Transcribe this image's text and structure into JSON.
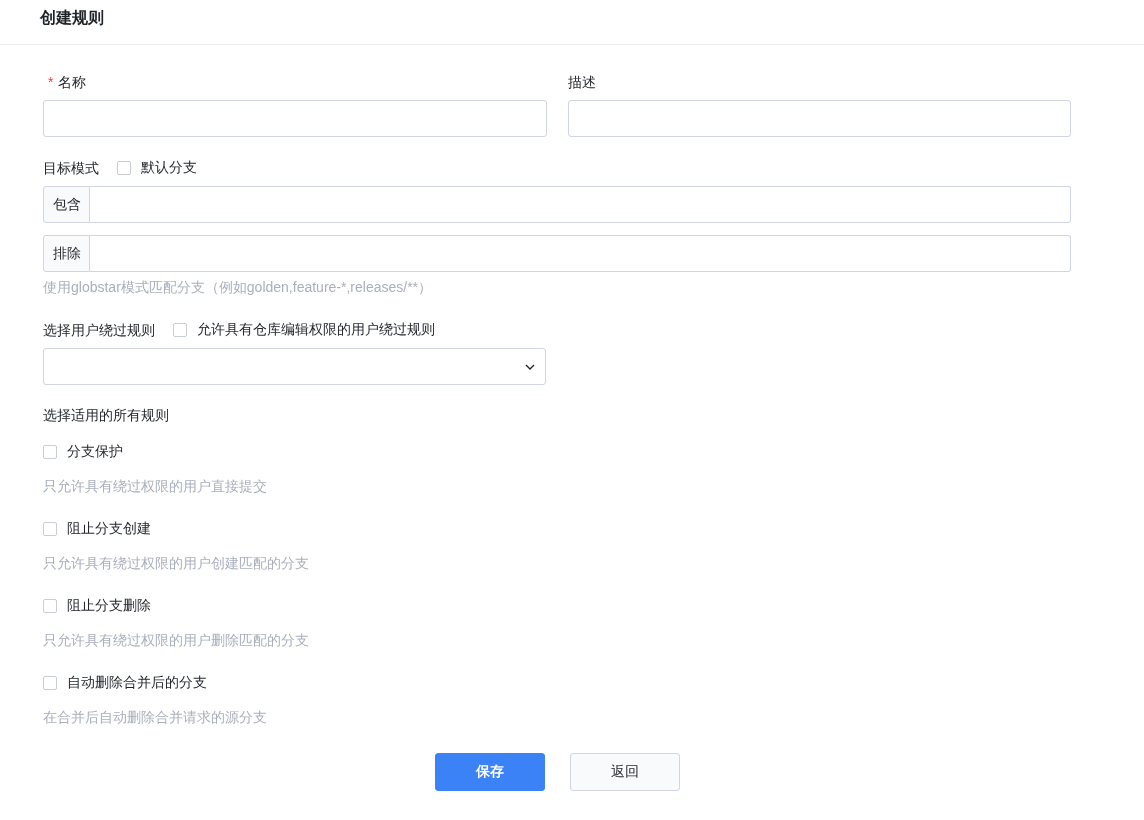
{
  "title": "创建规则",
  "name_field": {
    "required_mark": "*",
    "label": "名称"
  },
  "description_field": {
    "label": "描述"
  },
  "target_pattern": {
    "label": "目标模式",
    "default_branch": {
      "label": "默认分支",
      "checked": false
    },
    "include": {
      "addon": "包含"
    },
    "exclude": {
      "addon": "排除"
    },
    "hint": "使用globstar模式匹配分支（例如golden,feature-*,releases/**）"
  },
  "bypass": {
    "label": "选择用户绕过规则",
    "allow_editors": {
      "label": "允许具有仓库编辑权限的用户绕过规则",
      "checked": false
    }
  },
  "rules": {
    "label": "选择适用的所有规则",
    "items": [
      {
        "label": "分支保护",
        "description": "只允许具有绕过权限的用户直接提交",
        "checked": false
      },
      {
        "label": "阻止分支创建",
        "description": "只允许具有绕过权限的用户创建匹配的分支",
        "checked": false
      },
      {
        "label": "阻止分支删除",
        "description": "只允许具有绕过权限的用户删除匹配的分支",
        "checked": false
      },
      {
        "label": "自动删除合并后的分支",
        "description": "在合并后自动删除合并请求的源分支",
        "checked": false
      }
    ]
  },
  "buttons": [
    {
      "label": "保存",
      "kind": "primary"
    },
    {
      "label": "返回",
      "kind": "default"
    }
  ]
}
